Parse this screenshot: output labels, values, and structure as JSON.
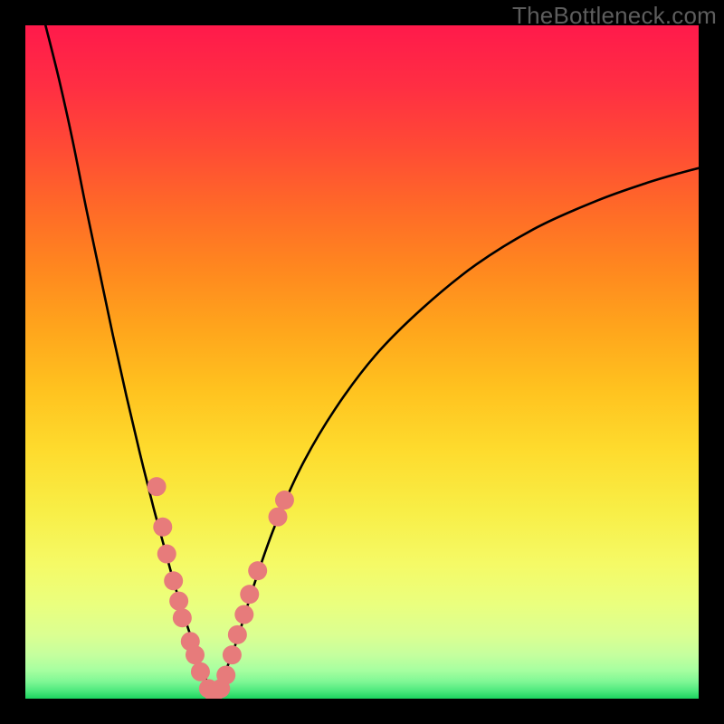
{
  "watermark": "TheBottleneck.com",
  "chart_data": {
    "type": "line",
    "title": "",
    "xlabel": "",
    "ylabel": "",
    "xlim": [
      0,
      100
    ],
    "ylim": [
      0,
      100
    ],
    "grid": false,
    "legend": false,
    "series": [
      {
        "name": "left-branch",
        "stroke": "#000000",
        "x": [
          3,
          5,
          7,
          9,
          11,
          13,
          15,
          17,
          19,
          20.5,
          22,
          23.5,
          25,
          26,
          27,
          28
        ],
        "y": [
          100,
          92,
          83,
          73,
          63.5,
          54,
          45,
          36.5,
          28.5,
          23,
          17.5,
          12.5,
          8,
          5,
          2.5,
          0.5
        ]
      },
      {
        "name": "right-branch",
        "stroke": "#000000",
        "x": [
          28,
          29,
          30.5,
          32,
          34,
          37,
          41,
          46,
          52,
          59,
          67,
          76,
          85,
          92,
          97,
          100
        ],
        "y": [
          0.5,
          2.5,
          6,
          10.5,
          17,
          25.5,
          34.5,
          43,
          51,
          58,
          64.5,
          70,
          74,
          76.5,
          78,
          78.8
        ]
      }
    ],
    "scatter": {
      "name": "dots",
      "fill": "#e77b7b",
      "radius": 10.5,
      "points": [
        {
          "x": 19.5,
          "y": 31.5
        },
        {
          "x": 20.4,
          "y": 25.5
        },
        {
          "x": 21.0,
          "y": 21.5
        },
        {
          "x": 22.0,
          "y": 17.5
        },
        {
          "x": 22.8,
          "y": 14.5
        },
        {
          "x": 23.3,
          "y": 12.0
        },
        {
          "x": 24.5,
          "y": 8.5
        },
        {
          "x": 25.2,
          "y": 6.5
        },
        {
          "x": 26.0,
          "y": 4.0
        },
        {
          "x": 27.2,
          "y": 1.5
        },
        {
          "x": 28.0,
          "y": 0.8
        },
        {
          "x": 29.0,
          "y": 1.5
        },
        {
          "x": 29.8,
          "y": 3.5
        },
        {
          "x": 30.7,
          "y": 6.5
        },
        {
          "x": 31.5,
          "y": 9.5
        },
        {
          "x": 32.5,
          "y": 12.5
        },
        {
          "x": 33.3,
          "y": 15.5
        },
        {
          "x": 34.5,
          "y": 19.0
        },
        {
          "x": 37.5,
          "y": 27.0
        },
        {
          "x": 38.5,
          "y": 29.5
        }
      ]
    },
    "gradient_stops": [
      {
        "offset": 0.0,
        "color": "#ff1a4b"
      },
      {
        "offset": 0.09,
        "color": "#ff2e43"
      },
      {
        "offset": 0.18,
        "color": "#ff4a35"
      },
      {
        "offset": 0.27,
        "color": "#ff6928"
      },
      {
        "offset": 0.36,
        "color": "#ff871f"
      },
      {
        "offset": 0.45,
        "color": "#ffa51c"
      },
      {
        "offset": 0.54,
        "color": "#ffc21f"
      },
      {
        "offset": 0.63,
        "color": "#fedb2d"
      },
      {
        "offset": 0.72,
        "color": "#f8ee46"
      },
      {
        "offset": 0.8,
        "color": "#f5fa66"
      },
      {
        "offset": 0.86,
        "color": "#eaff7e"
      },
      {
        "offset": 0.905,
        "color": "#dbff91"
      },
      {
        "offset": 0.935,
        "color": "#c5ff9e"
      },
      {
        "offset": 0.958,
        "color": "#a6ffa0"
      },
      {
        "offset": 0.975,
        "color": "#7ef794"
      },
      {
        "offset": 0.988,
        "color": "#4fe97e"
      },
      {
        "offset": 1.0,
        "color": "#1cd45f"
      }
    ]
  }
}
